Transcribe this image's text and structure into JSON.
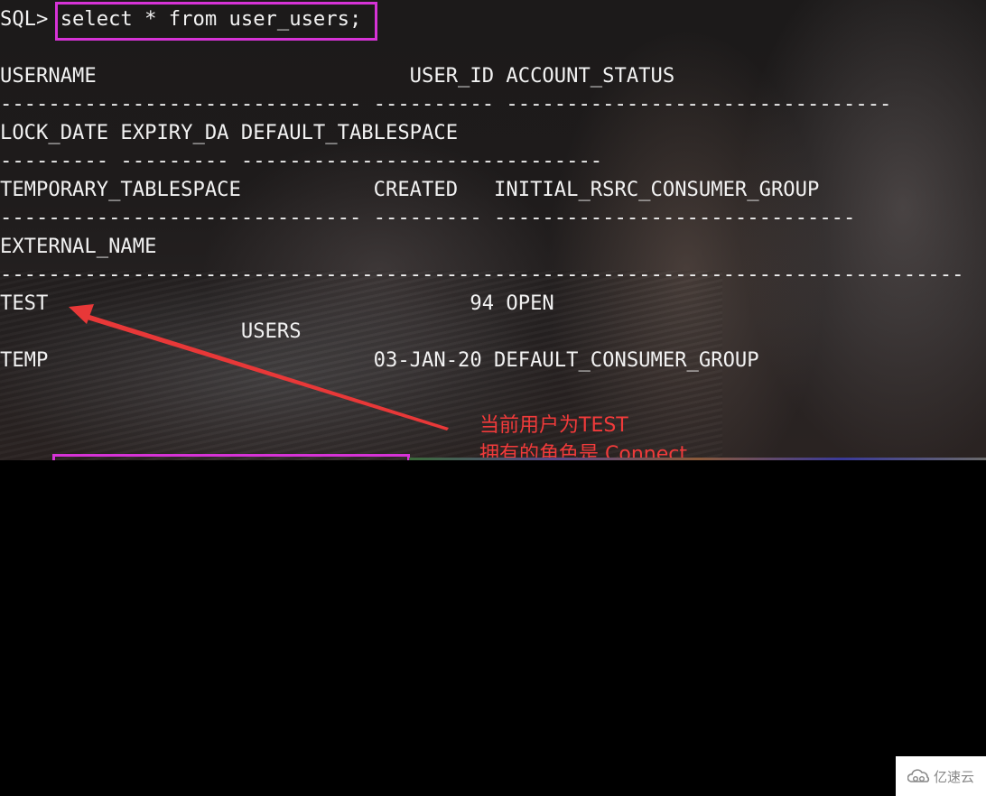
{
  "terminal": {
    "prompt": "SQL> ",
    "command": "select * from user_users;",
    "lines": [
      "USERNAME                          USER_ID ACCOUNT_STATUS",
      "------------------------------ ---------- --------------------------------",
      "LOCK_DATE EXPIRY_DA DEFAULT_TABLESPACE",
      "--------- --------- ------------------------------",
      "TEMPORARY_TABLESPACE           CREATED   INITIAL_RSRC_CONSUMER_GROUP",
      "------------------------------ --------- ------------------------------",
      "EXTERNAL_NAME",
      "--------------------------------------------------------------------------------",
      "TEST                                   94 OPEN",
      "                    USERS",
      "TEMP                           03-JAN-20 DEFAULT_CONSUMER_GROUP"
    ]
  },
  "result": {
    "username": "TEST",
    "user_id": "94",
    "account_status": "OPEN",
    "default_tablespace": "USERS",
    "temporary_tablespace": "TEMP",
    "created": "03-JAN-20",
    "initial_rsrc_consumer_group": "DEFAULT_CONSUMER_GROUP"
  },
  "annotation": {
    "line1": "当前用户为TEST",
    "line2": "拥有的角色是 Connect",
    "color": "#f03a3a"
  },
  "highlight_color": "#d633d6",
  "watermark": {
    "icon": "cloud-logo-icon",
    "text": "亿速云"
  }
}
